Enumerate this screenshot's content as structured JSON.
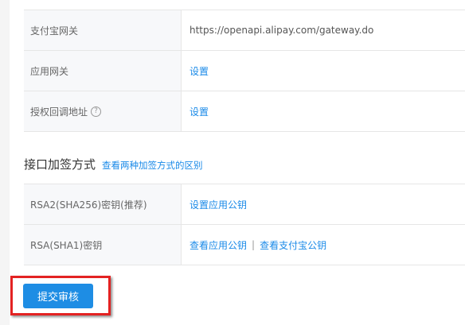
{
  "gateway_table": {
    "rows": [
      {
        "label": "支付宝网关",
        "value": "https://openapi.alipay.com/gateway.do"
      },
      {
        "label": "应用网关",
        "value": "设置"
      },
      {
        "label": "授权回调地址",
        "help_icon": "question-circle-icon",
        "value": "设置"
      }
    ]
  },
  "signing_section": {
    "title": "接口加签方式",
    "link": "查看两种加签方式的区别",
    "rows": [
      {
        "label": "RSA2(SHA256)密钥(推荐)",
        "link": "设置应用公钥"
      },
      {
        "label": "RSA(SHA1)密钥",
        "links": [
          "查看应用公钥",
          "查看支付宝公钥"
        ],
        "separator": "|"
      }
    ]
  },
  "submit_button": {
    "label": "提交审核"
  },
  "colors": {
    "link": "#1a8ae8",
    "button": "#1e8de4",
    "highlight": "#e32222"
  }
}
